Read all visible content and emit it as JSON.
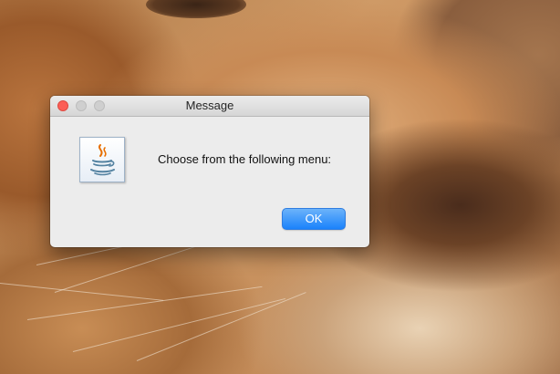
{
  "dialog": {
    "title": "Message",
    "message": "Choose from the following menu:",
    "icon": "java-cup-icon",
    "ok_label": "OK"
  },
  "colors": {
    "close_button": "#fc5f57",
    "inactive_button": "#cfcfcf",
    "ok_button": "#1a82fb"
  }
}
